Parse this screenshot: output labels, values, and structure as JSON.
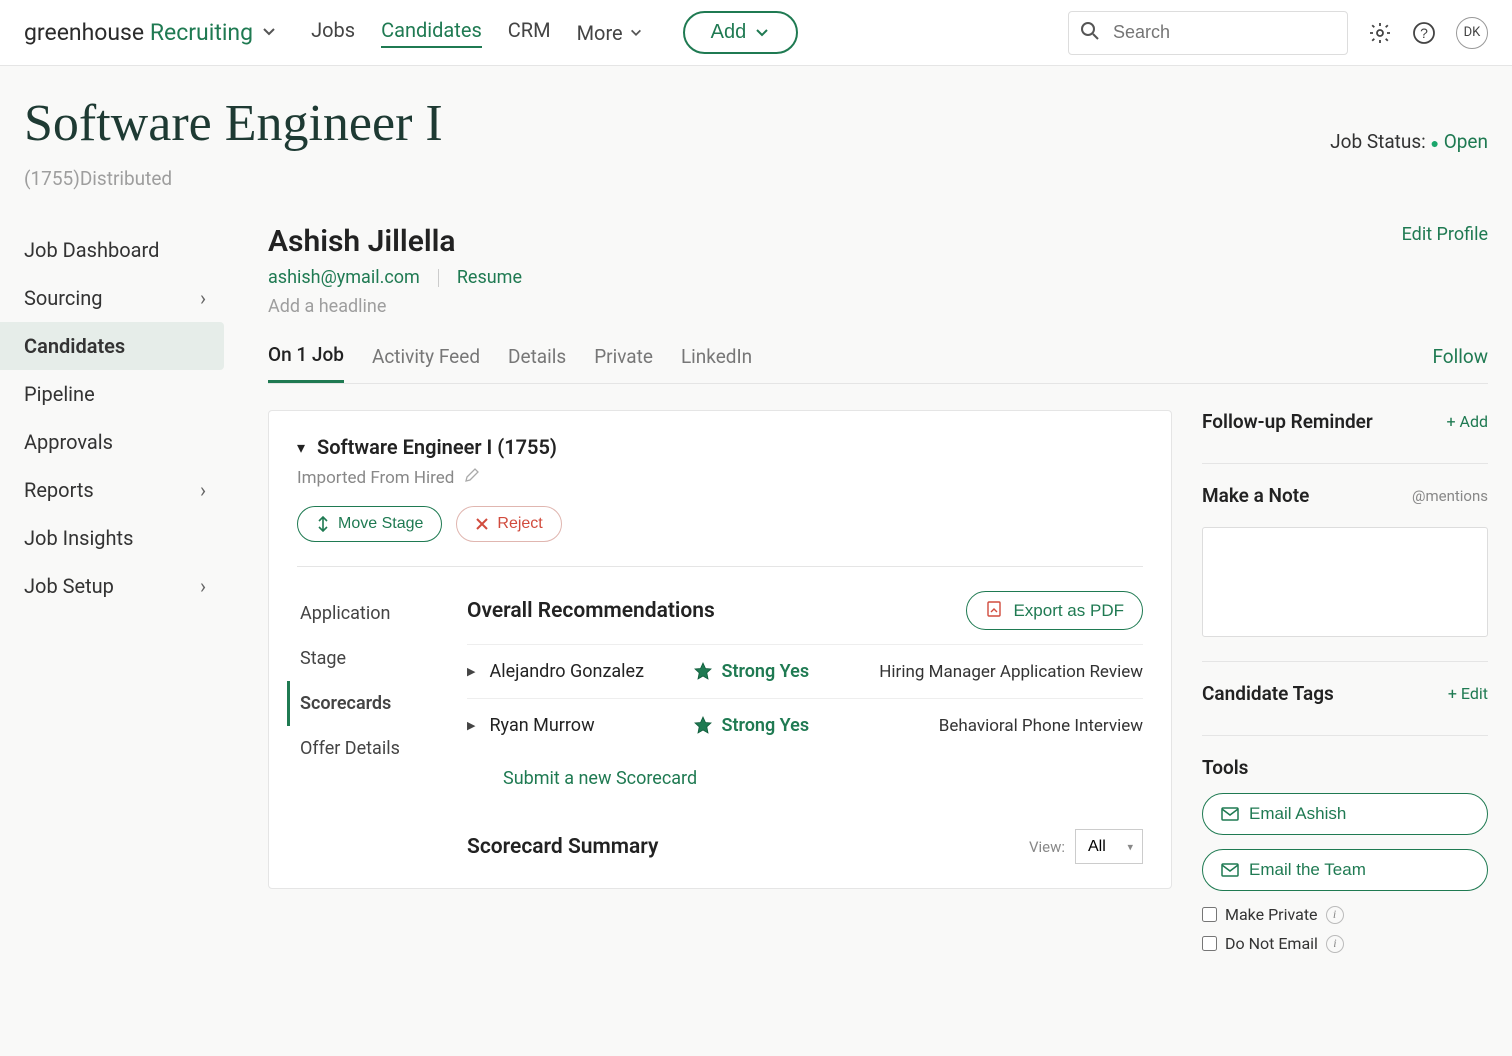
{
  "brand": {
    "part1": "greenhouse",
    "part2": "Recruiting"
  },
  "topnav": {
    "jobs": "Jobs",
    "candidates": "Candidates",
    "crm": "CRM",
    "more": "More",
    "add": "Add"
  },
  "search": {
    "placeholder": "Search"
  },
  "avatar": "DK",
  "page": {
    "title": "Software Engineer I",
    "sub": "(1755)Distributed",
    "status_label": "Job Status:",
    "status_value": "Open"
  },
  "sidebar": {
    "items": [
      {
        "label": "Job Dashboard",
        "chev": false
      },
      {
        "label": "Sourcing",
        "chev": true
      },
      {
        "label": "Candidates",
        "chev": false
      },
      {
        "label": "Pipeline",
        "chev": false
      },
      {
        "label": "Approvals",
        "chev": false
      },
      {
        "label": "Reports",
        "chev": true
      },
      {
        "label": "Job Insights",
        "chev": false
      },
      {
        "label": "Job Setup",
        "chev": true
      }
    ]
  },
  "candidate": {
    "name": "Ashish Jillella",
    "email": "ashish@ymail.com",
    "resume": "Resume",
    "headline": "Add a headline",
    "edit": "Edit Profile"
  },
  "tabs": {
    "on_job": "On 1 Job",
    "activity": "Activity Feed",
    "details": "Details",
    "private": "Private",
    "linkedin": "LinkedIn",
    "follow": "Follow"
  },
  "jobcard": {
    "title": "Software Engineer I (1755)",
    "imported": "Imported From Hired",
    "move_stage": "Move Stage",
    "reject": "Reject"
  },
  "inner_nav": {
    "application": "Application",
    "stage": "Stage",
    "scorecards": "Scorecards",
    "offer": "Offer Details"
  },
  "recs": {
    "heading": "Overall Recommendations",
    "export": "Export as PDF",
    "rows": [
      {
        "name": "Alejandro Gonzalez",
        "rating": "Strong Yes",
        "stage": "Hiring Manager Application Review"
      },
      {
        "name": "Ryan Murrow",
        "rating": "Strong Yes",
        "stage": "Behavioral Phone Interview"
      }
    ],
    "submit": "Submit a new Scorecard"
  },
  "summary": {
    "heading": "Scorecard Summary",
    "view_label": "View:",
    "view_value": "All"
  },
  "right": {
    "followup": "Follow-up Reminder",
    "add": "+ Add",
    "note": "Make a Note",
    "mentions": "@mentions",
    "tags": "Candidate Tags",
    "edit": "+ Edit",
    "tools": "Tools",
    "email_cand": "Email Ashish",
    "email_team": "Email the Team",
    "make_private": "Make Private",
    "do_not_email": "Do Not Email"
  }
}
